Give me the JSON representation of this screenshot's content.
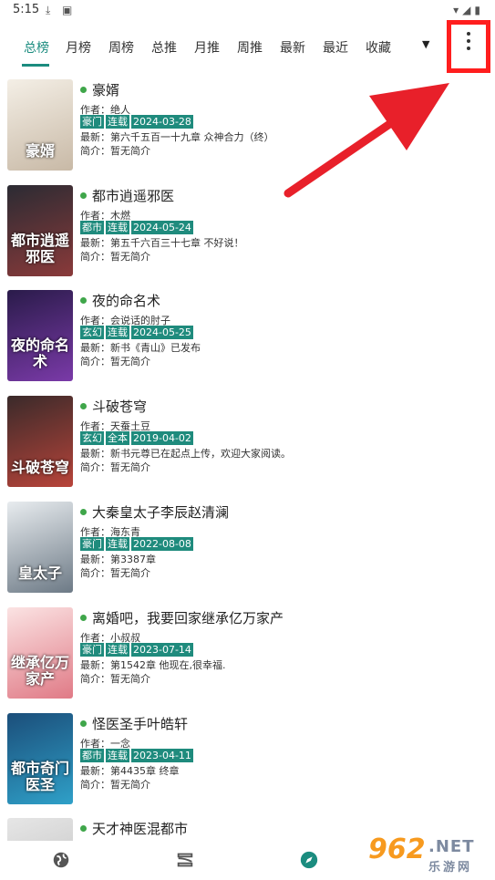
{
  "status_bar": {
    "time": "5:15"
  },
  "tabs": [
    {
      "label": "总榜",
      "active": true
    },
    {
      "label": "月榜"
    },
    {
      "label": "周榜"
    },
    {
      "label": "总推"
    },
    {
      "label": "月推"
    },
    {
      "label": "周推"
    },
    {
      "label": "最新"
    },
    {
      "label": "最近"
    },
    {
      "label": "收藏"
    }
  ],
  "colors": {
    "accent": "#1b8c7f",
    "tag_bg": "#1f8b7d",
    "dot": "#3fa64a",
    "highlight": "#ff1e1e",
    "arrow": "#e8202a"
  },
  "books": [
    {
      "title": "豪婿",
      "author": "作者：绝人",
      "tags": [
        "豪门",
        "连载",
        "2024-03-28"
      ],
      "latest": "最新：第六千五百一十九章 众神合力（终）",
      "intro": "简介：暂无简介",
      "cover_text": "豪婿",
      "cover_colors": [
        "#f4efe6",
        "#c8b9a6"
      ]
    },
    {
      "title": "都市逍遥邪医",
      "author": "作者：木燃",
      "tags": [
        "都市",
        "连载",
        "2024-05-24"
      ],
      "latest": "最新：第五千六百三十七章 不好说！",
      "intro": "简介：暂无简介",
      "cover_text": "都市逍遥邪医",
      "cover_colors": [
        "#2b2b33",
        "#8a3a3a"
      ]
    },
    {
      "title": "夜的命名术",
      "author": "作者：会说话的肘子",
      "tags": [
        "玄幻",
        "连载",
        "2024-05-25"
      ],
      "latest": "最新：新书《青山》已发布",
      "intro": "简介：暂无简介",
      "cover_text": "夜的命名术",
      "cover_colors": [
        "#2a1b4a",
        "#7a3aa8"
      ]
    },
    {
      "title": "斗破苍穹",
      "author": "作者：天蚕土豆",
      "tags": [
        "玄幻",
        "全本",
        "2019-04-02"
      ],
      "latest": "最新：新书元尊已在起点上传，欢迎大家阅读。",
      "intro": "简介：暂无简介",
      "cover_text": "斗破苍穹",
      "cover_colors": [
        "#3a2a2a",
        "#b8443a"
      ]
    },
    {
      "title": "大秦皇太子李辰赵清澜",
      "author": "作者：海东青",
      "tags": [
        "豪门",
        "连载",
        "2022-08-08"
      ],
      "latest": "最新：第3387章",
      "intro": "简介：暂无简介",
      "cover_text": "皇太子",
      "cover_colors": [
        "#e8ecef",
        "#6d7a86"
      ]
    },
    {
      "title": "离婚吧，我要回家继承亿万家产",
      "author": "作者：小叔叔",
      "tags": [
        "豪门",
        "连载",
        "2023-07-14"
      ],
      "latest": "最新：第1542章 他现在,很幸福.",
      "intro": "简介：暂无简介",
      "cover_text": "继承亿万家产",
      "cover_colors": [
        "#fbe3e3",
        "#e07a86"
      ]
    },
    {
      "title": "怪医圣手叶皓轩",
      "author": "作者：一念",
      "tags": [
        "都市",
        "连载",
        "2023-04-11"
      ],
      "latest": "最新：第4435章 终章",
      "intro": "简介：暂无简介",
      "cover_text": "都市奇门医圣",
      "cover_colors": [
        "#1b4e7a",
        "#2fa0c8"
      ]
    },
    {
      "title": "天才神医混都市",
      "author": "",
      "tags": [],
      "latest": "",
      "intro": "",
      "cover_text": "",
      "cover_colors": [
        "#e6e6e6",
        "#bdbdbd"
      ]
    }
  ],
  "bottom_nav": [
    {
      "icon": "globe-icon"
    },
    {
      "icon": "bookshelf-icon"
    },
    {
      "icon": "compass-icon",
      "active": true
    }
  ],
  "watermark": {
    "number": "962",
    "net": ".NET",
    "sub": "乐游网"
  }
}
